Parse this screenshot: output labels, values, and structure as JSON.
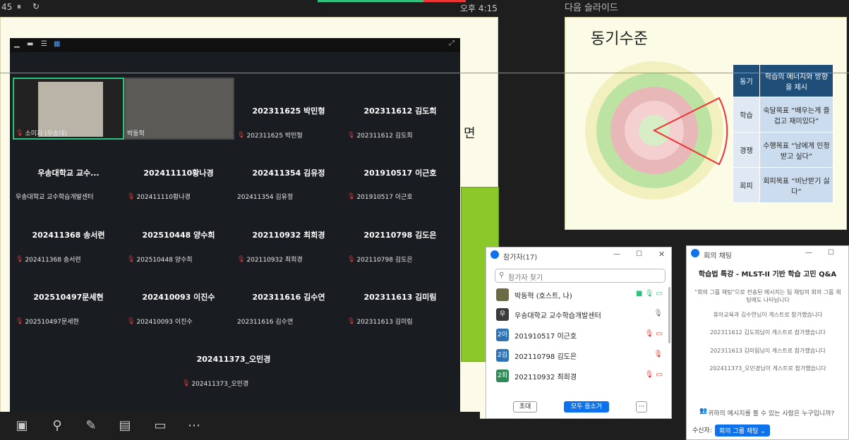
{
  "topbar": {
    "left_text": "45",
    "time": "오후 4:15"
  },
  "next_slide": {
    "label": "다음 슬라이드",
    "title": "동기수준",
    "table": {
      "header": [
        "동기",
        "학습의 에너지와 방향을 제시"
      ],
      "rows": [
        {
          "key": "학습",
          "value": "숙달목표 “배우는게 즐겁고 재미있다”"
        },
        {
          "key": "경쟁",
          "value": "수행목표 “남에게 인정받고 싶다”"
        },
        {
          "key": "회피",
          "value": "회피목표 “비난받기 싫다”"
        }
      ]
    }
  },
  "main_slide": {
    "partial_text": "면"
  },
  "gallery": {
    "video_tiles": [
      {
        "name": "소미자 (우송대)"
      },
      {
        "name": "박동혁"
      }
    ],
    "tiles": [
      {
        "title": "202311625 박민형",
        "sub": "202311625 박민형"
      },
      {
        "title": "202311612 김도희",
        "sub": "202311612 김도희"
      },
      {
        "title": "우송대학교 교수...",
        "sub": "우송대학교 교수학습개발센터"
      },
      {
        "title": "202411110황나경",
        "sub": "202411110황나경"
      },
      {
        "title": "202411354 김유정",
        "sub": "202411354 김유정"
      },
      {
        "title": "201910517 이근호",
        "sub": "201910517 이근호"
      },
      {
        "title": "202411368 송서련",
        "sub": "202411368 송서련"
      },
      {
        "title": "202510448 양수희",
        "sub": "202510448 양수희"
      },
      {
        "title": "202110932 최희경",
        "sub": "202110932 최희경"
      },
      {
        "title": "202110798 김도은",
        "sub": "202110798 김도은"
      },
      {
        "title": "202510497문세현",
        "sub": "202510497문세현"
      },
      {
        "title": "202410093 이진수",
        "sub": "202410093 이진수"
      },
      {
        "title": "202311616 김수연",
        "sub": "202311616 김수연"
      },
      {
        "title": "202311613 김미림",
        "sub": "202311613 김미림"
      },
      {
        "title": "202411373_오민경",
        "sub": "202411373_오민경"
      }
    ]
  },
  "participants": {
    "title": "참가자(17)",
    "search_placeholder": "참가자 찾기",
    "rows": [
      {
        "avatar": "",
        "name": "박동혁 (호스트, 나)"
      },
      {
        "avatar": "우",
        "name": "우송대학교 교수학습개발센터"
      },
      {
        "avatar": "2이",
        "name": "201910517 이근호"
      },
      {
        "avatar": "2김",
        "name": "202110798 김도은"
      },
      {
        "avatar": "2최",
        "name": "202110932 최희경"
      }
    ],
    "invite_label": "초대",
    "mute_all_label": "모두 음소거",
    "more_label": "···"
  },
  "chat": {
    "title": "회의 채팅",
    "meeting_title": "학습법 특강 - MLST-II 기반 학습 고민 Q&A",
    "messages": [
      "\"회의 그룹 채팅\"으로 전송된 메시지는 팀 채팅의 회의 그룹 채팅에도 나타납니다",
      "휴아교육과 김수연님이 게스트로 참가했습니다",
      "202311612 김도희님이 게스트로 참가했습니다",
      "202311613 김미림님이 게스트로 참가했습니다",
      "202411373_오민경님이 게스트로 참가했습니다"
    ],
    "notice": "귀하의 메시지를 볼 수 있는 사람은 누구입니까?",
    "to_label": "수신자:",
    "to_value": "회의 그룹 채팅 ⌄"
  },
  "colors": {
    "accent": "#0e72ed",
    "gallery_bg": "#191c20",
    "active_speaker": "#2ec27e"
  }
}
